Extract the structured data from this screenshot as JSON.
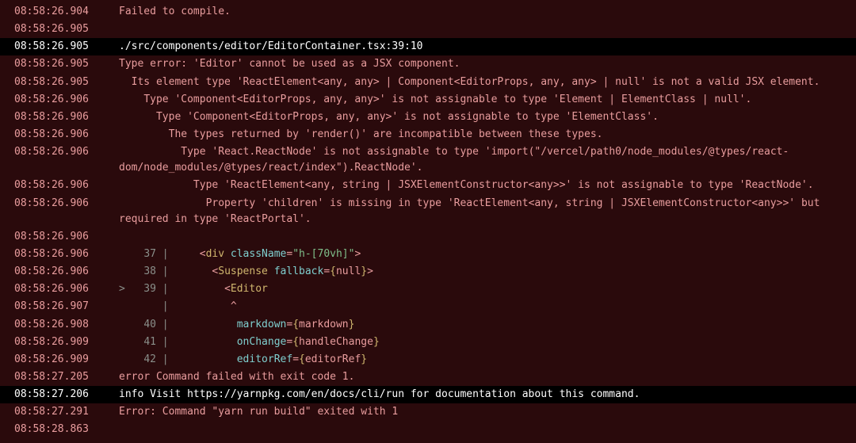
{
  "lines": [
    {
      "ts": "08:58:26.904",
      "sel": false,
      "plain": "Failed to compile."
    },
    {
      "ts": "08:58:26.905",
      "sel": false,
      "plain": ""
    },
    {
      "ts": "08:58:26.905",
      "sel": true,
      "plain": "./src/components/editor/EditorContainer.tsx:39:10"
    },
    {
      "ts": "08:58:26.905",
      "sel": false,
      "plain": "Type error: 'Editor' cannot be used as a JSX component."
    },
    {
      "ts": "08:58:26.905",
      "sel": false,
      "plain": "  Its element type 'ReactElement<any, any> | Component<EditorProps, any, any> | null' is not a valid JSX element."
    },
    {
      "ts": "08:58:26.906",
      "sel": false,
      "plain": "    Type 'Component<EditorProps, any, any>' is not assignable to type 'Element | ElementClass | null'."
    },
    {
      "ts": "08:58:26.906",
      "sel": false,
      "plain": "      Type 'Component<EditorProps, any, any>' is not assignable to type 'ElementClass'."
    },
    {
      "ts": "08:58:26.906",
      "sel": false,
      "plain": "        The types returned by 'render()' are incompatible between these types."
    },
    {
      "ts": "08:58:26.906",
      "sel": false,
      "plain": "          Type 'React.ReactNode' is not assignable to type 'import(\"/vercel/path0/node_modules/@types/react-dom/node_modules/@types/react/index\").ReactNode'."
    },
    {
      "ts": "08:58:26.906",
      "sel": false,
      "plain": "            Type 'ReactElement<any, string | JSXElementConstructor<any>>' is not assignable to type 'ReactNode'."
    },
    {
      "ts": "08:58:26.906",
      "sel": false,
      "plain": "              Property 'children' is missing in type 'ReactElement<any, string | JSXElementConstructor<any>>' but required in type 'ReactPortal'."
    },
    {
      "ts": "08:58:26.906",
      "sel": false,
      "plain": ""
    },
    {
      "ts": "08:58:26.906",
      "sel": false,
      "code": {
        "marker": " ",
        "ln": "37",
        "segments": [
          {
            "t": "    ",
            "cls": ""
          },
          {
            "t": "<",
            "cls": "punct"
          },
          {
            "t": "div",
            "cls": "tag"
          },
          {
            "t": " ",
            "cls": ""
          },
          {
            "t": "className",
            "cls": "attr"
          },
          {
            "t": "=",
            "cls": "punct"
          },
          {
            "t": "\"h-[70vh]\"",
            "cls": "val-str"
          },
          {
            "t": ">",
            "cls": "punct"
          }
        ]
      }
    },
    {
      "ts": "08:58:26.906",
      "sel": false,
      "code": {
        "marker": " ",
        "ln": "38",
        "segments": [
          {
            "t": "      ",
            "cls": ""
          },
          {
            "t": "<",
            "cls": "punct"
          },
          {
            "t": "Suspense",
            "cls": "tag"
          },
          {
            "t": " ",
            "cls": ""
          },
          {
            "t": "fallback",
            "cls": "attr"
          },
          {
            "t": "=",
            "cls": "punct"
          },
          {
            "t": "{",
            "cls": "brace"
          },
          {
            "t": "null",
            "cls": "punct"
          },
          {
            "t": "}",
            "cls": "brace"
          },
          {
            "t": ">",
            "cls": "punct"
          }
        ]
      }
    },
    {
      "ts": "08:58:26.906",
      "sel": false,
      "code": {
        "marker": ">",
        "ln": "39",
        "segments": [
          {
            "t": "        ",
            "cls": ""
          },
          {
            "t": "<",
            "cls": "punct"
          },
          {
            "t": "Editor",
            "cls": "tag"
          }
        ]
      }
    },
    {
      "ts": "08:58:26.907",
      "sel": false,
      "code": {
        "marker": " ",
        "ln": "  ",
        "caret": true,
        "caret_col": 9
      }
    },
    {
      "ts": "08:58:26.908",
      "sel": false,
      "code": {
        "marker": " ",
        "ln": "40",
        "segments": [
          {
            "t": "          ",
            "cls": ""
          },
          {
            "t": "markdown",
            "cls": "attr"
          },
          {
            "t": "=",
            "cls": "punct"
          },
          {
            "t": "{",
            "cls": "brace"
          },
          {
            "t": "markdown",
            "cls": "punct"
          },
          {
            "t": "}",
            "cls": "brace"
          }
        ]
      }
    },
    {
      "ts": "08:58:26.909",
      "sel": false,
      "code": {
        "marker": " ",
        "ln": "41",
        "segments": [
          {
            "t": "          ",
            "cls": ""
          },
          {
            "t": "onChange",
            "cls": "attr"
          },
          {
            "t": "=",
            "cls": "punct"
          },
          {
            "t": "{",
            "cls": "brace"
          },
          {
            "t": "handleChange",
            "cls": "punct"
          },
          {
            "t": "}",
            "cls": "brace"
          }
        ]
      }
    },
    {
      "ts": "08:58:26.909",
      "sel": false,
      "code": {
        "marker": " ",
        "ln": "42",
        "segments": [
          {
            "t": "          ",
            "cls": ""
          },
          {
            "t": "editorRef",
            "cls": "attr"
          },
          {
            "t": "=",
            "cls": "punct"
          },
          {
            "t": "{",
            "cls": "brace"
          },
          {
            "t": "editorRef",
            "cls": "punct"
          },
          {
            "t": "}",
            "cls": "brace"
          }
        ]
      }
    },
    {
      "ts": "08:58:27.205",
      "sel": false,
      "plain": "error Command failed with exit code 1."
    },
    {
      "ts": "08:58:27.206",
      "sel": true,
      "plain": "info Visit https://yarnpkg.com/en/docs/cli/run for documentation about this command."
    },
    {
      "ts": "08:58:27.291",
      "sel": false,
      "plain": "Error: Command \"yarn run build\" exited with 1"
    },
    {
      "ts": "08:58:28.863",
      "sel": false,
      "plain": ""
    }
  ]
}
